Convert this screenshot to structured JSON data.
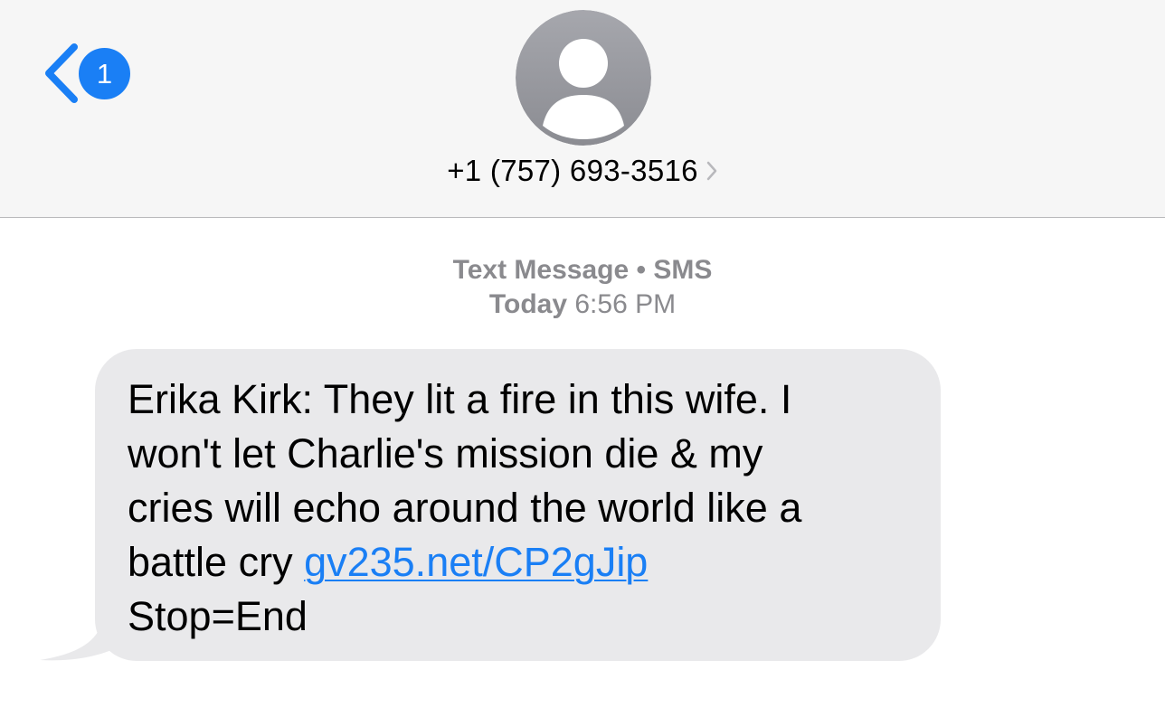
{
  "header": {
    "back_badge_count": "1",
    "contact_name": "+1 (757) 693-3516"
  },
  "conversation": {
    "service_label": "Text Message",
    "service_separator": "•",
    "service_type": "SMS",
    "day_label": "Today",
    "time_label": "6:56 PM",
    "messages": [
      {
        "direction": "incoming",
        "lines": [
          "Erika Kirk: They lit a fire in this wife. I",
          "won't let Charlie's mission die & my",
          "cries will echo around the world like a",
          "battle cry "
        ],
        "link_text": "gv235.net/CP2gJip",
        "last_line": "Stop=End"
      }
    ]
  },
  "colors": {
    "accent": "#1a7ff5",
    "header_bg": "#f6f6f6",
    "bubble_bg": "#e9e9eb",
    "avatar_bg": "#9a9ba1",
    "meta_text": "#8a8a8e"
  },
  "icons": {
    "back": "chevron-left-icon",
    "avatar": "person-silhouette-icon",
    "disclosure": "chevron-right-icon"
  }
}
